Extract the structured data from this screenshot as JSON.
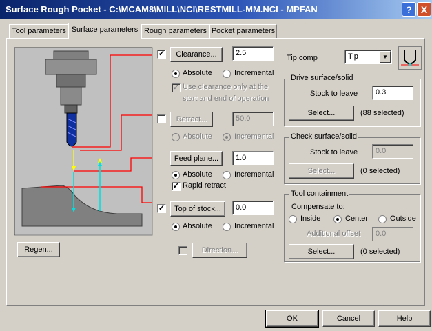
{
  "window": {
    "title": "Surface Rough Pocket - C:\\MCAM8\\MILL\\NCI\\RESTMILL-MM.NCI - MPFAN",
    "help_label": "?",
    "close_label": "X"
  },
  "tabs": [
    "Tool parameters",
    "Surface parameters",
    "Rough parameters",
    "Pocket parameters"
  ],
  "clearance": {
    "checked": true,
    "button": "Clearance...",
    "value": "2.5",
    "absolute": "Absolute",
    "incremental": "Incremental",
    "selected": "absolute",
    "note_line1": "Use clearance only at the",
    "note_line2": "start and end of operation"
  },
  "retract": {
    "checked": false,
    "button": "Retract...",
    "value": "50.0",
    "absolute": "Absolute",
    "incremental": "Incremental",
    "selected": "incremental"
  },
  "feed_plane": {
    "button": "Feed plane...",
    "value": "1.0",
    "absolute": "Absolute",
    "incremental": "Incremental",
    "selected": "absolute",
    "rapid_retract": "Rapid retract",
    "rapid_retract_checked": true
  },
  "top_of_stock": {
    "checked": true,
    "button": "Top of stock...",
    "value": "0.0",
    "absolute": "Absolute",
    "incremental": "Incremental",
    "selected": "absolute"
  },
  "direction": {
    "checked": false,
    "button": "Direction..."
  },
  "regen_button": "Regen...",
  "tip_comp": {
    "label": "Tip comp",
    "value": "Tip"
  },
  "drive_surface": {
    "title": "Drive surface/solid",
    "stock_label": "Stock to leave",
    "stock_value": "0.3",
    "select_button": "Select...",
    "selected_text": "(88  selected)"
  },
  "check_surface": {
    "title": "Check surface/solid",
    "stock_label": "Stock to leave",
    "stock_value": "0.0",
    "select_button": "Select...",
    "selected_text": "(0  selected)"
  },
  "containment": {
    "title": "Tool containment",
    "compensate_label": "Compensate to:",
    "options": [
      "Inside",
      "Center",
      "Outside"
    ],
    "selected": "Center",
    "offset_label": "Additional offset",
    "offset_value": "0.0",
    "select_button": "Select...",
    "selected_text": "(0  selected)"
  },
  "footer": {
    "ok": "OK",
    "cancel": "Cancel",
    "help": "Help"
  },
  "colors": {
    "title_start": "#0a246a",
    "title_end": "#a6caf0",
    "preview_bg": "#c0c0c0",
    "tool_blue": "#1030a0",
    "level_line": "#ff0000",
    "arrow_yellow": "#ffff00",
    "arrow_cyan": "#00e0e0"
  }
}
